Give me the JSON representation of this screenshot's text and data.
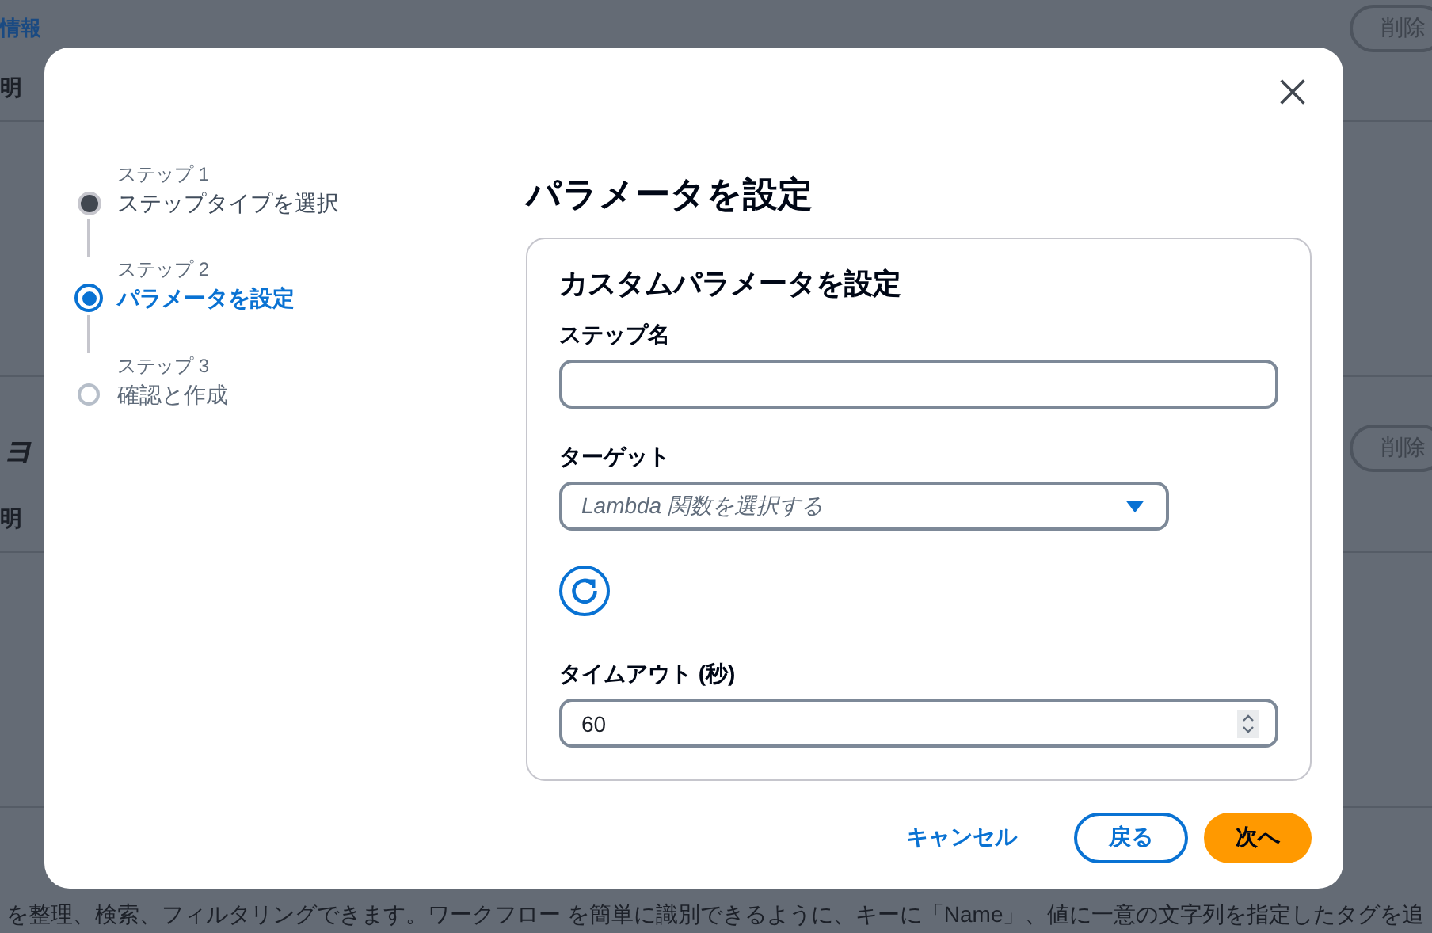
{
  "background": {
    "sections": [
      {
        "link": "情報",
        "label": "明",
        "button": "削除"
      },
      {
        "heading": "ョ",
        "label": "明",
        "button": "削除"
      }
    ],
    "footer_text": "を整理、検索、フィルタリングできます。ワークフロー を簡単に識別できるように、キーに「Name」、値に一意の文字列を指定したタグを追"
  },
  "dialog": {
    "steps": [
      {
        "caption": "ステップ 1",
        "label": "ステップタイプを選択",
        "completed": true,
        "selected": false
      },
      {
        "caption": "ステップ 2",
        "label": "パラメータを設定",
        "completed": false,
        "selected": true
      },
      {
        "caption": "ステップ 3",
        "label": "確認と作成",
        "completed": false,
        "selected": false
      }
    ],
    "title": "パラメータを設定",
    "panel": {
      "heading": "カスタムパラメータを設定",
      "fields": [
        {
          "kind": "text",
          "label": "ステップ名"
        },
        {
          "kind": "select",
          "label": "ターゲット",
          "placeholder": "Lambda 関数を選択する"
        },
        {
          "kind": "refresh"
        },
        {
          "kind": "number",
          "label": "タイムアウト (秒)",
          "value": "60"
        }
      ]
    },
    "buttons": [
      {
        "kind": "link",
        "label": "キャンセル"
      },
      {
        "kind": "secondary",
        "label": "戻る"
      },
      {
        "kind": "primary",
        "label": "次へ"
      }
    ]
  }
}
